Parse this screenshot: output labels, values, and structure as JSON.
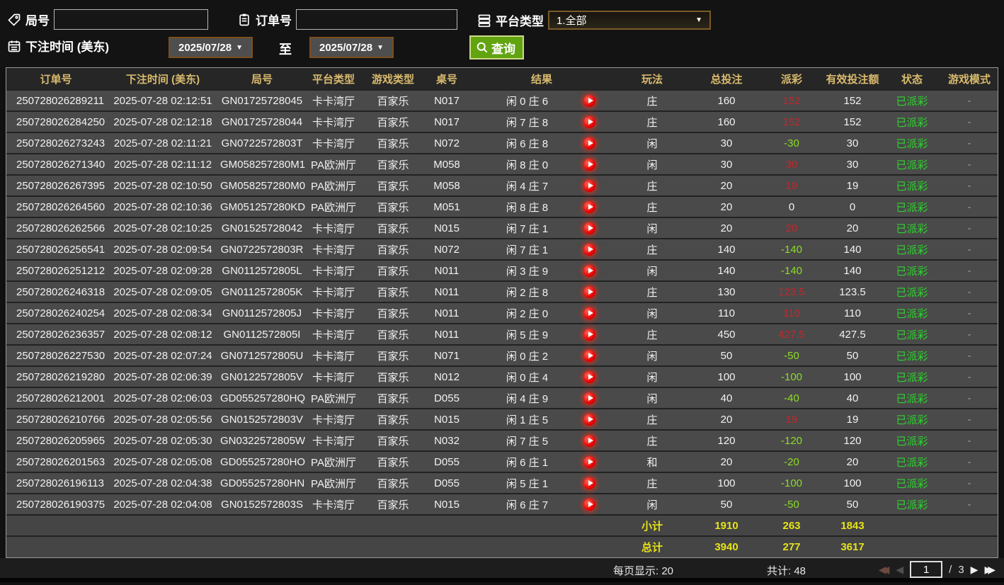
{
  "filters": {
    "round_label": "局号",
    "round_value": "",
    "order_label": "订单号",
    "order_value": "",
    "platform_label": "平台类型",
    "platform_value": "1.全部",
    "bet_time_label": "下注时间 (美东)",
    "date_from": "2025/07/28",
    "date_to": "2025/07/28",
    "to_label": "至",
    "search_label": "查询"
  },
  "table": {
    "columns": [
      "订单号",
      "下注时间 (美东)",
      "局号",
      "平台类型",
      "游戏类型",
      "桌号",
      "结果",
      "玩法",
      "总投注",
      "派彩",
      "有效投注额",
      "状态",
      "游戏模式"
    ],
    "rows": [
      {
        "order": "250728026289211",
        "time": "2025-07-28 02:12:51",
        "round": "GN01725728045",
        "platform": "卡卡湾厅",
        "game": "百家乐",
        "table_no": "N017",
        "result": "闲 0 庄 6",
        "play": "庄",
        "bet": "160",
        "payout": "152",
        "payout_class": "pos",
        "valid": "152",
        "status": "已派彩",
        "mode": "-"
      },
      {
        "order": "250728026284250",
        "time": "2025-07-28 02:12:18",
        "round": "GN01725728044",
        "platform": "卡卡湾厅",
        "game": "百家乐",
        "table_no": "N017",
        "result": "闲 7 庄 8",
        "play": "庄",
        "bet": "160",
        "payout": "152",
        "payout_class": "pos",
        "valid": "152",
        "status": "已派彩",
        "mode": "-"
      },
      {
        "order": "250728026273243",
        "time": "2025-07-28 02:11:21",
        "round": "GN0722572803T",
        "platform": "卡卡湾厅",
        "game": "百家乐",
        "table_no": "N072",
        "result": "闲 6 庄 8",
        "play": "闲",
        "bet": "30",
        "payout": "-30",
        "payout_class": "neg",
        "valid": "30",
        "status": "已派彩",
        "mode": "-"
      },
      {
        "order": "250728026271340",
        "time": "2025-07-28 02:11:12",
        "round": "GM058257280M1",
        "platform": "PA欧洲厅",
        "game": "百家乐",
        "table_no": "M058",
        "result": "闲 8 庄 0",
        "play": "闲",
        "bet": "30",
        "payout": "30",
        "payout_class": "pos",
        "valid": "30",
        "status": "已派彩",
        "mode": "-"
      },
      {
        "order": "250728026267395",
        "time": "2025-07-28 02:10:50",
        "round": "GM058257280M0",
        "platform": "PA欧洲厅",
        "game": "百家乐",
        "table_no": "M058",
        "result": "闲 4 庄 7",
        "play": "庄",
        "bet": "20",
        "payout": "19",
        "payout_class": "pos",
        "valid": "19",
        "status": "已派彩",
        "mode": "-"
      },
      {
        "order": "250728026264560",
        "time": "2025-07-28 02:10:36",
        "round": "GM051257280KD",
        "platform": "PA欧洲厅",
        "game": "百家乐",
        "table_no": "M051",
        "result": "闲 8 庄 8",
        "play": "庄",
        "bet": "20",
        "payout": "0",
        "payout_class": "zero",
        "valid": "0",
        "status": "已派彩",
        "mode": "-"
      },
      {
        "order": "250728026262566",
        "time": "2025-07-28 02:10:25",
        "round": "GN01525728042",
        "platform": "卡卡湾厅",
        "game": "百家乐",
        "table_no": "N015",
        "result": "闲 7 庄 1",
        "play": "闲",
        "bet": "20",
        "payout": "20",
        "payout_class": "pos",
        "valid": "20",
        "status": "已派彩",
        "mode": "-"
      },
      {
        "order": "250728026256541",
        "time": "2025-07-28 02:09:54",
        "round": "GN0722572803R",
        "platform": "卡卡湾厅",
        "game": "百家乐",
        "table_no": "N072",
        "result": "闲 7 庄 1",
        "play": "庄",
        "bet": "140",
        "payout": "-140",
        "payout_class": "neg",
        "valid": "140",
        "status": "已派彩",
        "mode": "-"
      },
      {
        "order": "250728026251212",
        "time": "2025-07-28 02:09:28",
        "round": "GN0112572805L",
        "platform": "卡卡湾厅",
        "game": "百家乐",
        "table_no": "N011",
        "result": "闲 3 庄 9",
        "play": "闲",
        "bet": "140",
        "payout": "-140",
        "payout_class": "neg",
        "valid": "140",
        "status": "已派彩",
        "mode": "-"
      },
      {
        "order": "250728026246318",
        "time": "2025-07-28 02:09:05",
        "round": "GN0112572805K",
        "platform": "卡卡湾厅",
        "game": "百家乐",
        "table_no": "N011",
        "result": "闲 2 庄 8",
        "play": "庄",
        "bet": "130",
        "payout": "123.5",
        "payout_class": "pos",
        "valid": "123.5",
        "status": "已派彩",
        "mode": "-"
      },
      {
        "order": "250728026240254",
        "time": "2025-07-28 02:08:34",
        "round": "GN0112572805J",
        "platform": "卡卡湾厅",
        "game": "百家乐",
        "table_no": "N011",
        "result": "闲 2 庄 0",
        "play": "闲",
        "bet": "110",
        "payout": "110",
        "payout_class": "pos",
        "valid": "110",
        "status": "已派彩",
        "mode": "-"
      },
      {
        "order": "250728026236357",
        "time": "2025-07-28 02:08:12",
        "round": "GN0112572805I",
        "platform": "卡卡湾厅",
        "game": "百家乐",
        "table_no": "N011",
        "result": "闲 5 庄 9",
        "play": "庄",
        "bet": "450",
        "payout": "427.5",
        "payout_class": "pos",
        "valid": "427.5",
        "status": "已派彩",
        "mode": "-"
      },
      {
        "order": "250728026227530",
        "time": "2025-07-28 02:07:24",
        "round": "GN0712572805U",
        "platform": "卡卡湾厅",
        "game": "百家乐",
        "table_no": "N071",
        "result": "闲 0 庄 2",
        "play": "闲",
        "bet": "50",
        "payout": "-50",
        "payout_class": "neg",
        "valid": "50",
        "status": "已派彩",
        "mode": "-"
      },
      {
        "order": "250728026219280",
        "time": "2025-07-28 02:06:39",
        "round": "GN0122572805V",
        "platform": "卡卡湾厅",
        "game": "百家乐",
        "table_no": "N012",
        "result": "闲 0 庄 4",
        "play": "闲",
        "bet": "100",
        "payout": "-100",
        "payout_class": "neg",
        "valid": "100",
        "status": "已派彩",
        "mode": "-"
      },
      {
        "order": "250728026212001",
        "time": "2025-07-28 02:06:03",
        "round": "GD055257280HQ",
        "platform": "PA欧洲厅",
        "game": "百家乐",
        "table_no": "D055",
        "result": "闲 4 庄 9",
        "play": "闲",
        "bet": "40",
        "payout": "-40",
        "payout_class": "neg",
        "valid": "40",
        "status": "已派彩",
        "mode": "-"
      },
      {
        "order": "250728026210766",
        "time": "2025-07-28 02:05:56",
        "round": "GN0152572803V",
        "platform": "卡卡湾厅",
        "game": "百家乐",
        "table_no": "N015",
        "result": "闲 1 庄 5",
        "play": "庄",
        "bet": "20",
        "payout": "19",
        "payout_class": "pos",
        "valid": "19",
        "status": "已派彩",
        "mode": "-"
      },
      {
        "order": "250728026205965",
        "time": "2025-07-28 02:05:30",
        "round": "GN0322572805W",
        "platform": "卡卡湾厅",
        "game": "百家乐",
        "table_no": "N032",
        "result": "闲 7 庄 5",
        "play": "庄",
        "bet": "120",
        "payout": "-120",
        "payout_class": "neg",
        "valid": "120",
        "status": "已派彩",
        "mode": "-"
      },
      {
        "order": "250728026201563",
        "time": "2025-07-28 02:05:08",
        "round": "GD055257280HO",
        "platform": "PA欧洲厅",
        "game": "百家乐",
        "table_no": "D055",
        "result": "闲 6 庄 1",
        "play": "和",
        "bet": "20",
        "payout": "-20",
        "payout_class": "neg",
        "valid": "20",
        "status": "已派彩",
        "mode": "-"
      },
      {
        "order": "250728026196113",
        "time": "2025-07-28 02:04:38",
        "round": "GD055257280HN",
        "platform": "PA欧洲厅",
        "game": "百家乐",
        "table_no": "D055",
        "result": "闲 5 庄 1",
        "play": "庄",
        "bet": "100",
        "payout": "-100",
        "payout_class": "neg",
        "valid": "100",
        "status": "已派彩",
        "mode": "-"
      },
      {
        "order": "250728026190375",
        "time": "2025-07-28 02:04:08",
        "round": "GN0152572803S",
        "platform": "卡卡湾厅",
        "game": "百家乐",
        "table_no": "N015",
        "result": "闲 6 庄 7",
        "play": "闲",
        "bet": "50",
        "payout": "-50",
        "payout_class": "neg",
        "valid": "50",
        "status": "已派彩",
        "mode": "-"
      }
    ],
    "subtotal": {
      "label": "小计",
      "bet": "1910",
      "payout": "263",
      "valid": "1843"
    },
    "total": {
      "label": "总计",
      "bet": "3940",
      "payout": "277",
      "valid": "3617"
    }
  },
  "footer": {
    "per_page_label": "每页显示: 20",
    "total_label": "共计: 48",
    "current_page": "1",
    "page_separator": "/",
    "total_pages": "3"
  },
  "colors": {
    "header_text": "#d9ba6e",
    "payout_positive": "#c1282e",
    "payout_negative": "#8bdc26",
    "status_green": "#2ed32e",
    "summary_yellow": "#e6e317",
    "search_button_green": "#61a410",
    "date_border_brown": "#7c4f1c"
  }
}
